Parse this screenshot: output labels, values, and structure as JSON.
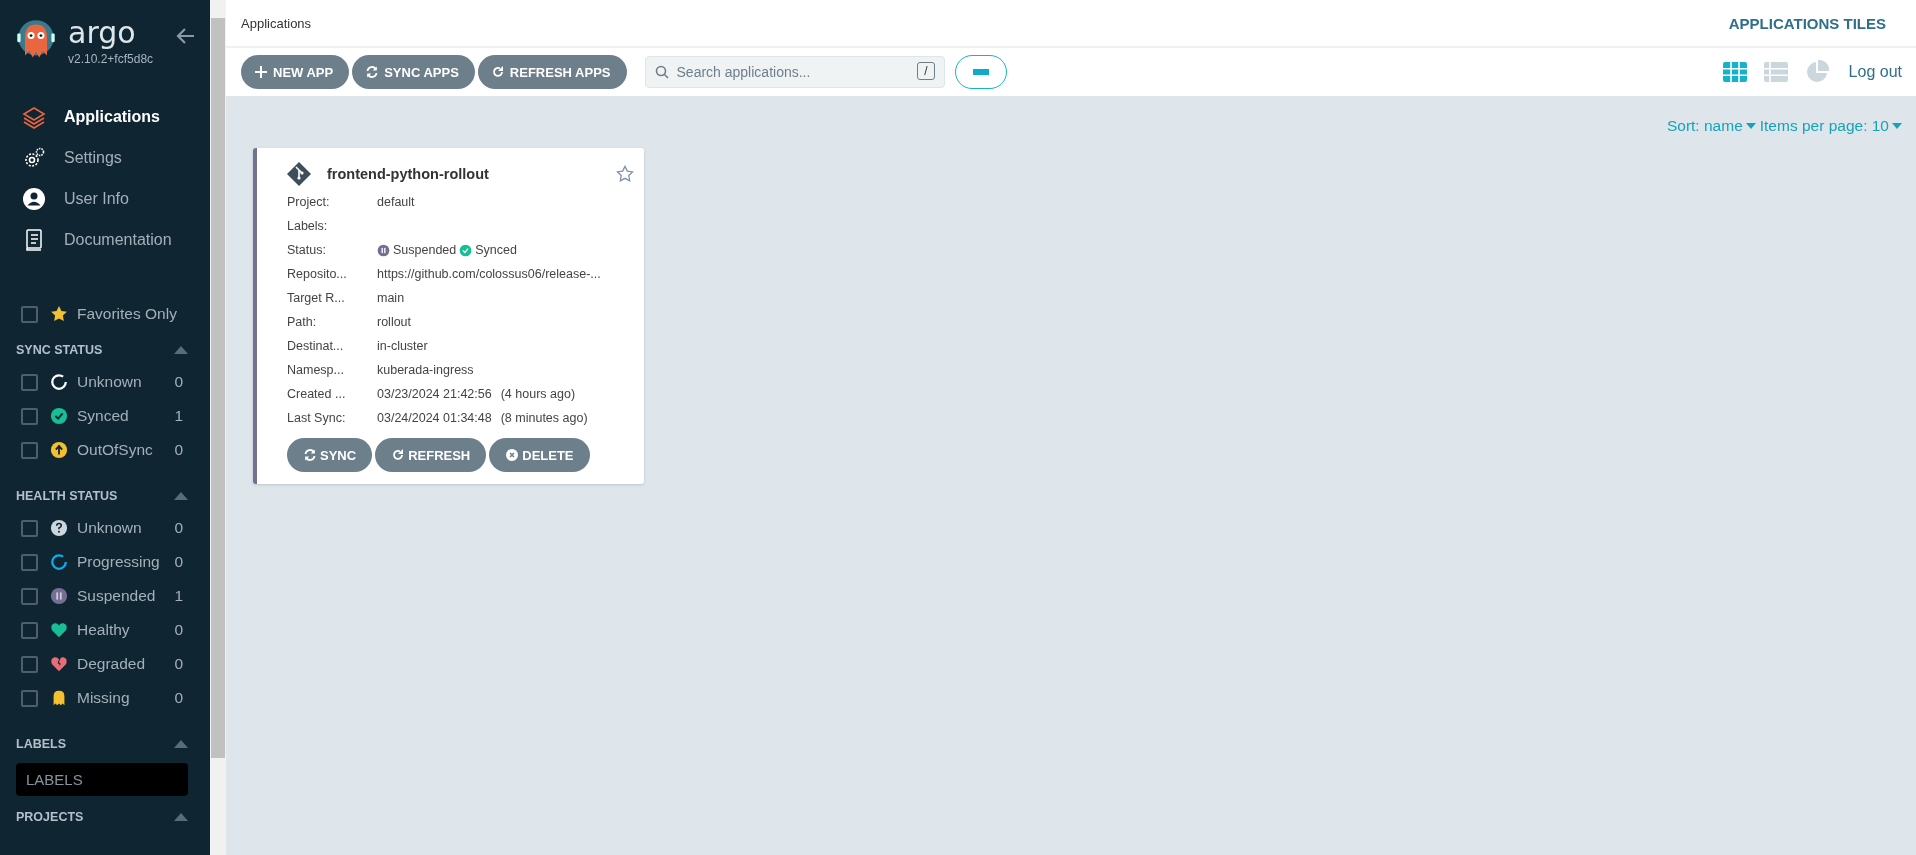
{
  "sidebar": {
    "brand": "argo",
    "version": "v2.10.2+fcf5d8c",
    "nav": [
      {
        "label": "Applications",
        "kind": "apps",
        "selected": true
      },
      {
        "label": "Settings",
        "kind": "settings",
        "selected": false
      },
      {
        "label": "User Info",
        "kind": "user",
        "selected": false
      },
      {
        "label": "Documentation",
        "kind": "docs",
        "selected": false
      }
    ],
    "favorites": {
      "label": "Favorites Only",
      "checked": false
    },
    "sections": [
      {
        "title": "SYNC STATUS",
        "expanded": true,
        "kind": "filters",
        "items": [
          {
            "label": "Unknown",
            "count": "0",
            "checked": false,
            "kind": "ring",
            "color": "#ffffff"
          },
          {
            "label": "Synced",
            "count": "1",
            "checked": false,
            "kind": "check",
            "color": "#18be94"
          },
          {
            "label": "OutOfSync",
            "count": "0",
            "checked": false,
            "kind": "arrow",
            "color": "#f4c030"
          }
        ]
      },
      {
        "title": "HEALTH STATUS",
        "expanded": true,
        "kind": "filters",
        "items": [
          {
            "label": "Unknown",
            "count": "0",
            "checked": false,
            "kind": "question",
            "color": "#ccd6dd"
          },
          {
            "label": "Progressing",
            "count": "0",
            "checked": false,
            "kind": "ring",
            "color": "#0dadea"
          },
          {
            "label": "Suspended",
            "count": "1",
            "checked": false,
            "kind": "pause",
            "color": "#766f94"
          },
          {
            "label": "Healthy",
            "count": "0",
            "checked": false,
            "kind": "heart",
            "color": "#18be94"
          },
          {
            "label": "Degraded",
            "count": "0",
            "checked": false,
            "kind": "broken",
            "color": "#e96d76"
          },
          {
            "label": "Missing",
            "count": "0",
            "checked": false,
            "kind": "ghost",
            "color": "#f4c030"
          }
        ]
      },
      {
        "title": "LABELS",
        "expanded": true,
        "kind": "input",
        "placeholder": "LABELS"
      },
      {
        "title": "PROJECTS",
        "expanded": true,
        "kind": "none"
      }
    ]
  },
  "header": {
    "breadcrumb": "Applications",
    "title": "APPLICATIONS TILES"
  },
  "toolbar": {
    "buttons": [
      {
        "label": "NEW APP",
        "kind": "plus"
      },
      {
        "label": "SYNC APPS",
        "kind": "sync"
      },
      {
        "label": "REFRESH APPS",
        "kind": "refresh"
      }
    ],
    "search": {
      "placeholder": "Search applications...",
      "key": "/"
    },
    "views": [
      {
        "kind": "tiles",
        "selected": true
      },
      {
        "kind": "list",
        "selected": false
      },
      {
        "kind": "summary",
        "selected": false
      }
    ],
    "logout": "Log out"
  },
  "sort": {
    "sort": "Sort: name",
    "per_page": "Items per page: 10"
  },
  "apps": [
    {
      "name": "frontend-python-rollout",
      "favorite": false,
      "color": "#766f94",
      "fields": [
        {
          "kind": "text",
          "label": "Project:",
          "value": "default"
        },
        {
          "kind": "text",
          "label": "Labels:"
        },
        {
          "kind": "status",
          "label": "Status:",
          "health": "Suspended",
          "sync": "Synced"
        },
        {
          "kind": "text",
          "label": "Reposito...",
          "value": "https://github.com/colossus06/release-..."
        },
        {
          "kind": "text",
          "label": "Target R...",
          "value": "main"
        },
        {
          "kind": "text",
          "label": "Path:",
          "value": "rollout"
        },
        {
          "kind": "text",
          "label": "Destinat...",
          "value": "in-cluster"
        },
        {
          "kind": "text",
          "label": "Namesp...",
          "value": "kuberada-ingress"
        },
        {
          "kind": "time",
          "label": "Created ...",
          "value": "03/23/2024 21:42:56",
          "ago": "(4 hours ago)"
        },
        {
          "kind": "time",
          "label": "Last Sync:",
          "value": "03/24/2024 01:34:48",
          "ago": "(8 minutes ago)"
        }
      ],
      "buttons": [
        {
          "label": "SYNC",
          "kind": "sync"
        },
        {
          "label": "REFRESH",
          "kind": "refresh"
        },
        {
          "label": "DELETE",
          "kind": "delete"
        }
      ]
    }
  ]
}
